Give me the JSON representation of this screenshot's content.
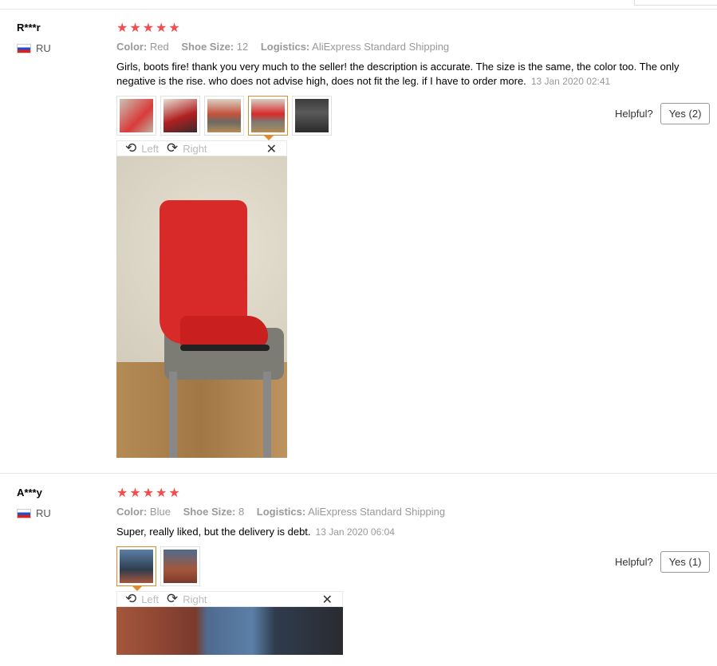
{
  "reviews": [
    {
      "user": "R***r",
      "country": "RU",
      "stars": 5,
      "labels": {
        "color": "Color:",
        "size": "Shoe Size:",
        "logistics": "Logistics:"
      },
      "color": "Red",
      "size": "12",
      "logistics": "AliExpress Standard Shipping",
      "text": "Girls, boots fire! thank you very much to the seller! the description is accurate. The size is the same, the color too. The only negative is the rise. who does not advise high, does not fit the leg. if I have to order more.",
      "date": "13 Jan 2020 02:41",
      "helpful_label": "Helpful?",
      "yes_label": "Yes (2)",
      "viewer": {
        "left": "Left",
        "right": "Right"
      }
    },
    {
      "user": "A***y",
      "country": "RU",
      "stars": 5,
      "labels": {
        "color": "Color:",
        "size": "Shoe Size:",
        "logistics": "Logistics:"
      },
      "color": "Blue",
      "size": "8",
      "logistics": "AliExpress Standard Shipping",
      "text": "Super, really liked, but the delivery is debt.",
      "date": "13 Jan 2020 06:04",
      "helpful_label": "Helpful?",
      "yes_label": "Yes (1)",
      "viewer": {
        "left": "Left",
        "right": "Right"
      }
    }
  ],
  "icons": {
    "star": "★",
    "rotate_left": "⟲",
    "rotate_right": "⟳",
    "close": "✕"
  },
  "colors": {
    "star": "#f44d4d",
    "active_thumb": "#e08a2c"
  }
}
